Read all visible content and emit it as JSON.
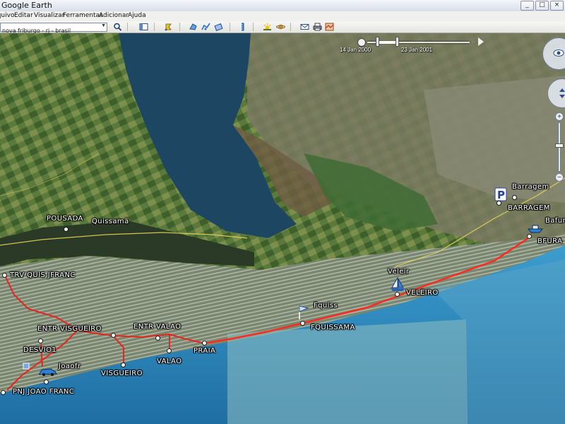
{
  "window": {
    "title": "Google Earth",
    "controls": [
      "_",
      "□",
      "×"
    ]
  },
  "menu": [
    "Arquivo",
    "Editar",
    "Visualizar",
    "Ferramentas",
    "Adicionar",
    "Ajuda"
  ],
  "search": {
    "value": "nova friburgo - rj - brasil"
  },
  "toolbar": {
    "icons": [
      "sidebar-toggle-icon",
      "placemark-icon",
      "polygon-icon",
      "path-icon",
      "overlay-icon",
      "ruler-icon",
      "sun-icon",
      "planet-icon",
      "email-icon",
      "print-icon",
      "maps-icon"
    ]
  },
  "timeslider": {
    "start": "14 Jan 2000",
    "end": "23 Jan 2001"
  },
  "places": {
    "pousada": "POUSADA",
    "quissama": "Quissamã",
    "trv": "TRV QUIS JFRANC",
    "entr_visgueiro": "ENTR VISGUEIRO",
    "entr_valao": "ENTR VALAO",
    "desvio": "DESVIO1",
    "praia": "PRAIA",
    "valao": "VALAO",
    "visgueiro": "VISGUEIRO",
    "joaofr": "Joaofr",
    "pnj": "PNJ JOAO FRANC",
    "fquiss": "Fquiss",
    "fquissama": "FQUISSAMA",
    "veleir": "Veleir",
    "veleiro": "VELEIRO",
    "barragem_small": "Barragem",
    "barragem": "BARRAGEM",
    "bafura": "Bafura",
    "bfura": "BFURA"
  },
  "colors": {
    "route": "#e8231c",
    "road": "#e6d25a",
    "sea": "#2e8fc4",
    "lagoon": "#1d4a66"
  }
}
